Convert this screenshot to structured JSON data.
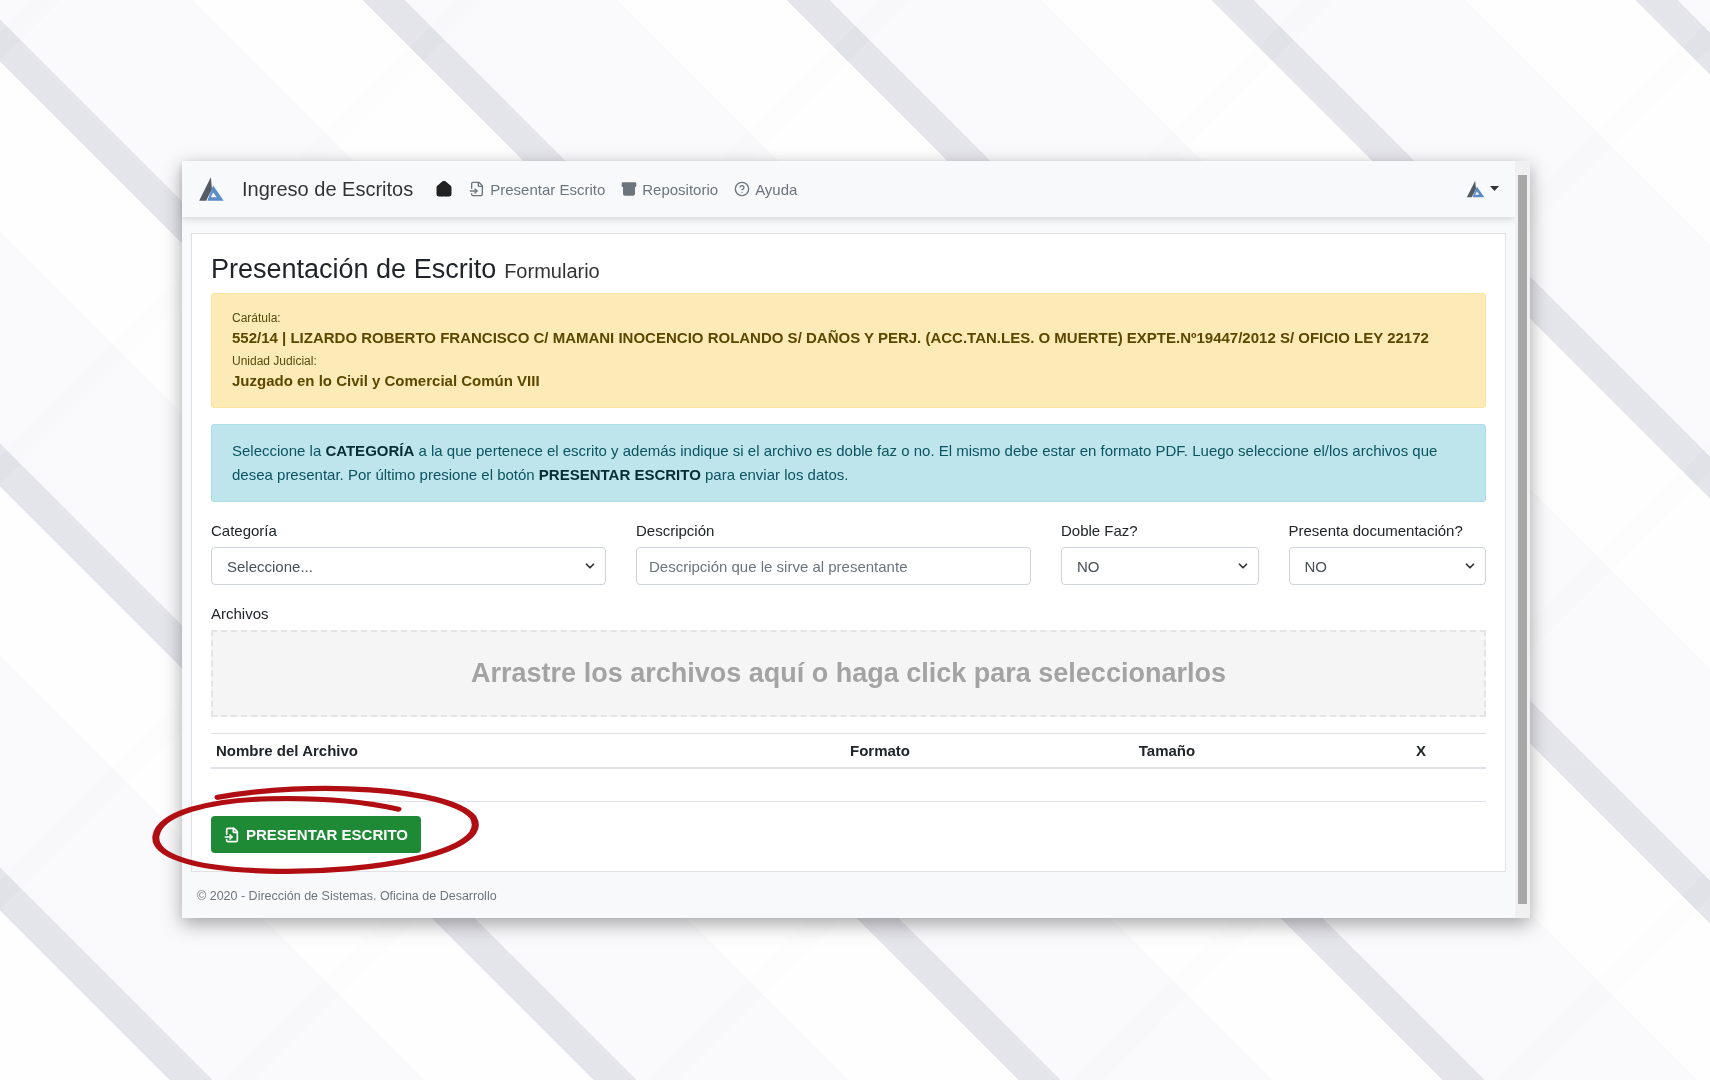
{
  "navbar": {
    "brand": "Ingreso de Escritos",
    "links": [
      {
        "kind": "home"
      },
      {
        "kind": "file-import",
        "label": "Presentar Escrito"
      },
      {
        "kind": "archive",
        "label": "Repositorio"
      },
      {
        "kind": "help",
        "label": "Ayuda"
      }
    ]
  },
  "page": {
    "title": "Presentación de Escrito",
    "subtitle": "Formulario"
  },
  "case_info": [
    {
      "label": "Carátula:",
      "value": "552/14 | LIZARDO ROBERTO FRANCISCO C/ MAMANI INOCENCIO ROLANDO S/ DAÑOS Y PERJ. (ACC.TAN.LES. O MUERTE) EXPTE.Nº19447/2012 S/ OFICIO LEY 22172"
    },
    {
      "label": "Unidad Judicial:",
      "value": "Juzgado en lo Civil y Comercial Común VIII"
    }
  ],
  "instructions": "Seleccione la **CATEGORÍA** a la que pertenece el escrito y además indique si el archivo es doble faz o no. El mismo debe estar en formato PDF. Luego seleccione el/los archivos que desea presentar. Por último presione el botón **PRESENTAR ESCRITO** para enviar los datos.",
  "fields": [
    {
      "kind": "select",
      "label": "Categoría",
      "value": "Seleccione..."
    },
    {
      "kind": "input",
      "label": "Descripción",
      "placeholder": "Descripción que le sirve al presentante"
    },
    {
      "kind": "select",
      "label": "Doble Faz?",
      "value": "NO"
    },
    {
      "kind": "select",
      "label": "Presenta documentación?",
      "value": "NO"
    }
  ],
  "files": {
    "label": "Archivos",
    "dropzone": "Arrastre los archivos aquí o haga click para seleccionarlos",
    "columns": [
      "Nombre del Archivo",
      "Formato",
      "Tamaño",
      "X"
    ]
  },
  "submit_button": "PRESENTAR ESCRITO",
  "footer": "© 2020 - Dirección de Sistemas. Oficina de Desarrollo"
}
